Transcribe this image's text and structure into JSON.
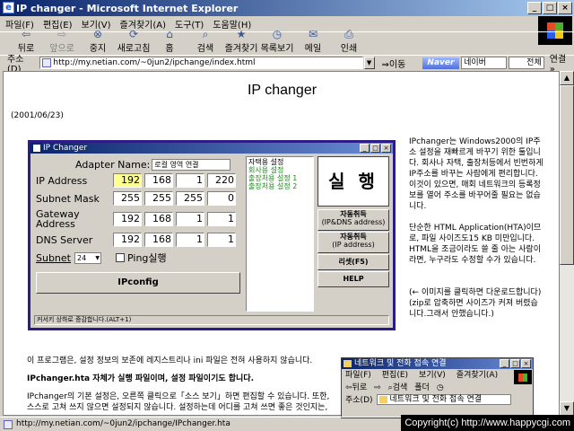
{
  "window": {
    "title": "IP changer - Microsoft Internet Explorer",
    "icon": "e",
    "buttons": [
      "_",
      "□",
      "×"
    ]
  },
  "menu": [
    "파일(F)",
    "편집(E)",
    "보기(V)",
    "즐겨찾기(A)",
    "도구(T)",
    "도움말(H)"
  ],
  "toolbar": [
    {
      "label": "뒤로",
      "icon": "back-arrow-icon",
      "glyph": "⇦"
    },
    {
      "label": "앞으로",
      "icon": "forward-arrow-icon",
      "glyph": "⇨"
    },
    {
      "label": "중지",
      "icon": "stop-icon",
      "glyph": "⊗"
    },
    {
      "label": "새로고침",
      "icon": "refresh-icon",
      "glyph": "⟳"
    },
    {
      "label": "홈",
      "icon": "home-icon",
      "glyph": "⌂"
    },
    {
      "label": "검색",
      "icon": "search-icon",
      "glyph": "⌕"
    },
    {
      "label": "즐겨찾기",
      "icon": "favorites-icon",
      "glyph": "★"
    },
    {
      "label": "목록보기",
      "icon": "history-icon",
      "glyph": "◷"
    },
    {
      "label": "메일",
      "icon": "mail-icon",
      "glyph": "✉"
    },
    {
      "label": "인쇄",
      "icon": "print-icon",
      "glyph": "⎙"
    }
  ],
  "address": {
    "label": "주소(D)",
    "url": "http://my.netian.com/~0jun2/ipchange/index.html",
    "go": "⇒이동",
    "search_brand": "Naver",
    "search_placeholder": "네이버",
    "search_scope": "전체",
    "links": "연결 »"
  },
  "page": {
    "title": "IP changer",
    "date": "(2001/06/23)",
    "side_text": [
      "IPchanger는 Windows2000의 IP주소 설정을 재빠르게 바꾸기 위한 툴입니다. 회사나 자택, 출장처등에서 빈번하게 IP주소를 바꾸는 사람에게 편리합니다. 이것이 있으면, 매회 네트워크의 등록정보를 열어 주소를 바꾸어줄 필요는 없습니다.",
      "단순한 HTML Application(HTA)이므로, 파일 사이즈도15 KB 미만입니다. HTML을 조금이라도 쓸 줄 아는 사람이라면, 누구라도 수정할 수가 있습니다."
    ],
    "side_note": "(← 이미지를 클릭하면 다운로드합니다) (zip로 압축하면 사이즈가 커져 버렸습니다.그래서 안했습니다.)",
    "body": {
      "line1": "이 프로그램은, 설정 정보의 보존에 레지스트리나 ini 파일은 전혀 사용하지 않습니다.",
      "line2": "IPchanger.hta 자체가 실행 파일이며, 설정 파일이기도 합니다.",
      "line3": "IPchanger의 기본 설정은, 오른쪽 클릭으로「소스 보기」하면 편집할 수 있습니다. 또한, 스스로 고쳐 쓰지 않으면 설정되지 않습니다. 설정하는데 어디를 고쳐 쓰면 좋은 것인지는,"
    }
  },
  "hta": {
    "title": "IP Changer",
    "adapter_label": "Adapter Name:",
    "adapter_value": "로컬 영역 연결",
    "fields": [
      {
        "label": "IP Address",
        "octets": [
          "192",
          "168",
          "1",
          "220"
        ]
      },
      {
        "label": "Subnet Mask",
        "octets": [
          "255",
          "255",
          "255",
          "0"
        ]
      },
      {
        "label": "Gateway Address",
        "octets": [
          "192",
          "168",
          "1",
          "1"
        ]
      },
      {
        "label": "DNS Server",
        "octets": [
          "192",
          "168",
          "1",
          "1"
        ]
      }
    ],
    "subnet_label": "Subnet",
    "subnet_value": "24",
    "ping_label": "Ping실행",
    "ipconfig_label": "IPconfig",
    "profiles": [
      "자택용 설정",
      "회사용 설정",
      "출장처용 설정 1",
      "출장처용 설정 2"
    ],
    "run_label": "실 행",
    "auto_ipdns": {
      "title": "자동취득",
      "sub": "(IP&DNS address)"
    },
    "auto_ip": {
      "title": "자동취득",
      "sub": "(IP address)"
    },
    "reset": "리셋(F5)",
    "help": "HELP",
    "status": "커서키 상하로 증감합니다.(ALT+1)"
  },
  "netwin": {
    "title": "네트워크 및 전화 접속 연결",
    "menu": [
      "파일(F)",
      "편집(E)",
      "보기(V)",
      "즐겨찾기(A)"
    ],
    "toolbar": [
      "⇦뒤로",
      "⇨",
      "⌕검색",
      "폴더",
      "◷"
    ],
    "address_label": "주소(D)",
    "address_value": "네트워크 및 전화 접속 연결"
  },
  "status": {
    "url": "http://my.netian.com/~0jun2/ipchange/IPchanger.hta",
    "copyright": "Copyright(c) http://www.happycgi.com"
  }
}
